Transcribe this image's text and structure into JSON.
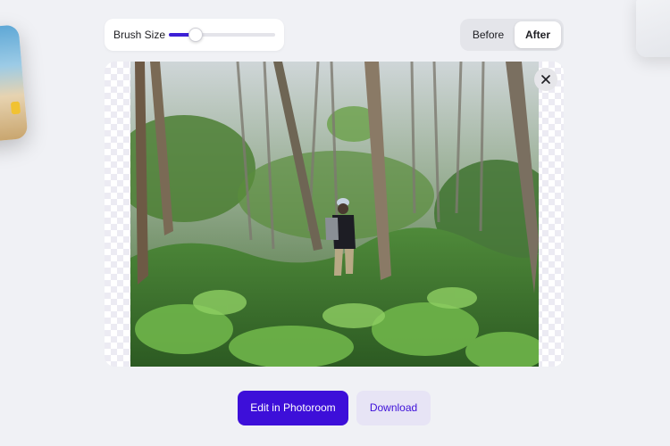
{
  "brush": {
    "label": "Brush Size",
    "value_fraction": 0.25
  },
  "view_toggle": {
    "before_label": "Before",
    "after_label": "After",
    "selected": "After"
  },
  "image": {
    "close_icon": "close-icon"
  },
  "actions": {
    "edit_label": "Edit in Photoroom",
    "download_label": "Download"
  },
  "colors": {
    "accent": "#3d0fd9",
    "secondary_bg": "#e7e4f5",
    "page_bg": "#f0f1f5"
  }
}
